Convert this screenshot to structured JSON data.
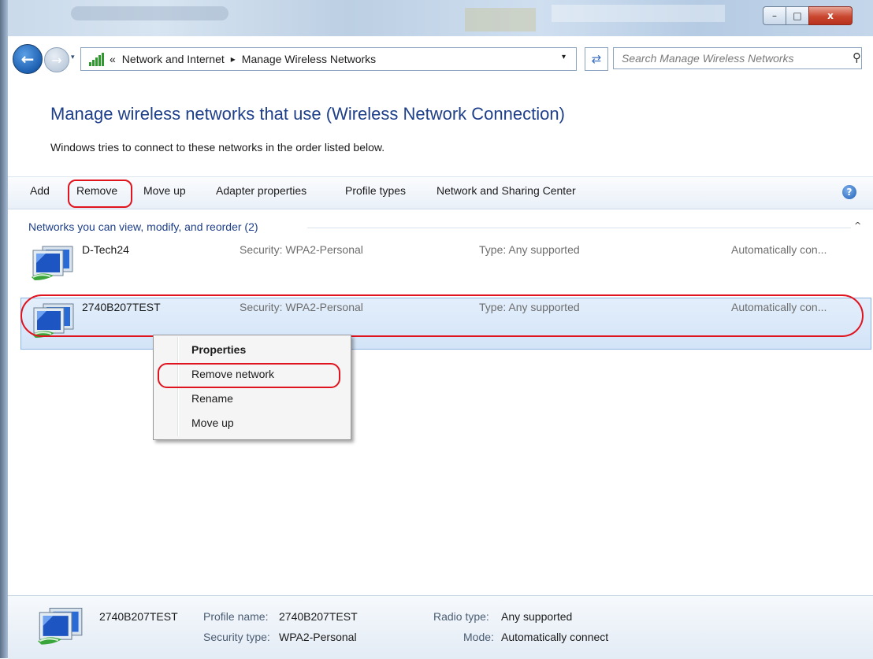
{
  "window": {
    "minimize_glyph": "–",
    "maximize_glyph": "□",
    "close_glyph": "x"
  },
  "addressbar": {
    "overflow": "«",
    "crumbs": [
      "Network and Internet",
      "Manage Wireless Networks"
    ],
    "separator": "▸",
    "dropdown": "▾",
    "search_placeholder": "Search Manage Wireless Networks"
  },
  "header": {
    "title": "Manage wireless networks that use (Wireless Network Connection)",
    "subtitle": "Windows tries to connect to these networks in the order listed below."
  },
  "commandbar": {
    "add": "Add",
    "remove": "Remove",
    "move_up": "Move up",
    "adapter_properties": "Adapter properties",
    "profile_types": "Profile types",
    "network_sharing_center": "Network and Sharing Center",
    "help": "?"
  },
  "group": {
    "header": "Networks you can view, modify, and reorder (2)",
    "collapse_glyph": "^"
  },
  "networks": [
    {
      "name": "D-Tech24",
      "security": "Security: WPA2-Personal",
      "type": "Type: Any supported",
      "mode": "Automatically con...",
      "selected": false
    },
    {
      "name": "2740B207TEST",
      "security": "Security: WPA2-Personal",
      "type": "Type: Any supported",
      "mode": "Automatically con...",
      "selected": true
    }
  ],
  "context_menu": {
    "items": [
      "Properties",
      "Remove network",
      "Rename",
      "Move up"
    ]
  },
  "details": {
    "name": "2740B207TEST",
    "profile_name_label": "Profile name:",
    "profile_name_value": "2740B207TEST",
    "security_type_label": "Security type:",
    "security_type_value": "WPA2-Personal",
    "radio_type_label": "Radio type:",
    "radio_type_value": "Any supported",
    "mode_label": "Mode:",
    "mode_value": "Automatically connect"
  },
  "colors": {
    "title_blue": "#1e3f8a",
    "annotation_red": "#e0141e",
    "selection_bg": "#d9e8fa"
  }
}
